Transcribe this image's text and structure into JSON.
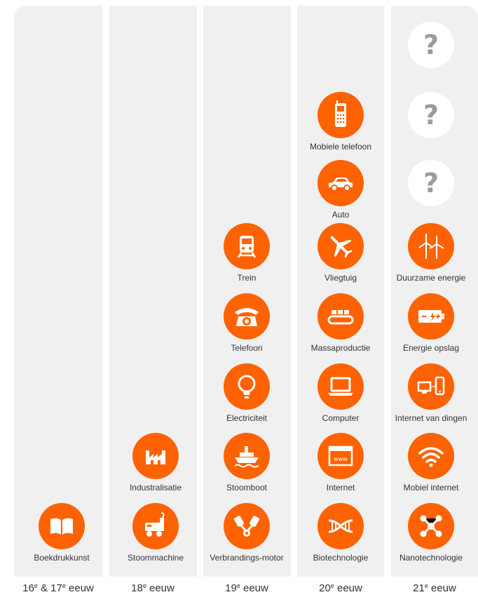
{
  "colors": {
    "accent": "#ff6200",
    "column_bg": "#f0f0f0",
    "unknown_circle": "#ffffff",
    "unknown_mark": "#9b9b9b"
  },
  "eras": [
    {
      "pre1": "16",
      "sup1": "e",
      "mid": " & 17",
      "sup2": "e",
      "post": " eeuw"
    },
    {
      "pre1": "18",
      "sup1": "e",
      "mid": "",
      "sup2": "",
      "post": " eeuw"
    },
    {
      "pre1": "19",
      "sup1": "e",
      "mid": "",
      "sup2": "",
      "post": " eeuw"
    },
    {
      "pre1": "20",
      "sup1": "e",
      "mid": "",
      "sup2": "",
      "post": " eeuw"
    },
    {
      "pre1": "21",
      "sup1": "e",
      "mid": "",
      "sup2": "",
      "post": " eeuw"
    }
  ],
  "inventions": {
    "c16": [
      {
        "label": "Boekdrukkunst",
        "icon": "book-icon"
      }
    ],
    "c18": [
      {
        "label": "Industralisatie",
        "icon": "factory-icon"
      },
      {
        "label": "Stoommachine",
        "icon": "steam-engine-icon"
      }
    ],
    "c19": [
      {
        "label": "Trein",
        "icon": "train-icon"
      },
      {
        "label": "Telefoon",
        "icon": "rotary-phone-icon"
      },
      {
        "label": "Electriciteit",
        "icon": "lightbulb-icon"
      },
      {
        "label": "Stoomboot",
        "icon": "steamboat-icon"
      },
      {
        "label": "Verbrandings-motor",
        "icon": "engine-pistons-icon"
      }
    ],
    "c20": [
      {
        "label": "Mobiele telefoon",
        "icon": "mobile-phone-icon"
      },
      {
        "label": "Auto",
        "icon": "car-icon"
      },
      {
        "label": "Vliegtuig",
        "icon": "airplane-icon"
      },
      {
        "label": "Massaproductie",
        "icon": "conveyor-belt-icon"
      },
      {
        "label": "Computer",
        "icon": "laptop-icon"
      },
      {
        "label": "Internet",
        "icon": "browser-www-icon"
      },
      {
        "label": "Biotechnologie",
        "icon": "dna-icon"
      }
    ],
    "c21": [
      {
        "label": "",
        "icon": "question-mark-icon",
        "mark": "?"
      },
      {
        "label": "",
        "icon": "question-mark-icon",
        "mark": "?"
      },
      {
        "label": "",
        "icon": "question-mark-icon",
        "mark": "?"
      },
      {
        "label": "Duurzame energie",
        "icon": "wind-turbine-icon"
      },
      {
        "label": "Energie opslag",
        "icon": "battery-icon"
      },
      {
        "label": "Internet van dingen",
        "icon": "devices-connected-icon"
      },
      {
        "label": "Mobiel internet",
        "icon": "wifi-icon"
      },
      {
        "label": "Nanotechnologie",
        "icon": "molecule-icon"
      }
    ]
  }
}
